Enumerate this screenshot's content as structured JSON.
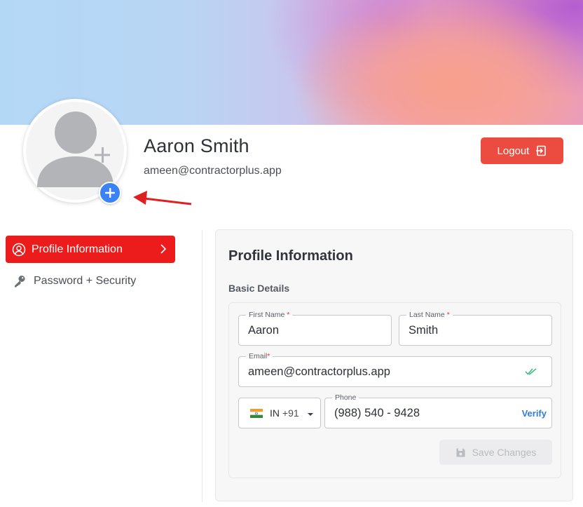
{
  "profile": {
    "name": "Aaron Smith",
    "email": "ameen@contractorplus.app",
    "logout_label": "Logout"
  },
  "sidebar": {
    "items": [
      {
        "label": "Profile Information",
        "icon": "user-circle-icon",
        "active": true
      },
      {
        "label": "Password + Security",
        "icon": "key-icon",
        "active": false
      }
    ]
  },
  "form": {
    "title": "Profile Information",
    "section": "Basic Details",
    "first_name": {
      "label": "First Name",
      "required_mark": "*",
      "value": "Aaron"
    },
    "last_name": {
      "label": "Last Name",
      "required_mark": "*",
      "value": "Smith"
    },
    "email": {
      "label": "Email",
      "required_mark": "*",
      "value": "ameen@contractorplus.app"
    },
    "country": {
      "code": "IN",
      "dial": "+91"
    },
    "phone": {
      "label": "Phone",
      "value": "(988) 540 - 9428",
      "verify_label": "Verify"
    },
    "save_label": "Save Changes"
  },
  "colors": {
    "accent_red": "#ec1c1c",
    "logout_red": "#ec4b3f",
    "link_blue": "#2f7be0",
    "avatar_add_blue": "#3b82f6",
    "verified_green": "#2bb673"
  }
}
